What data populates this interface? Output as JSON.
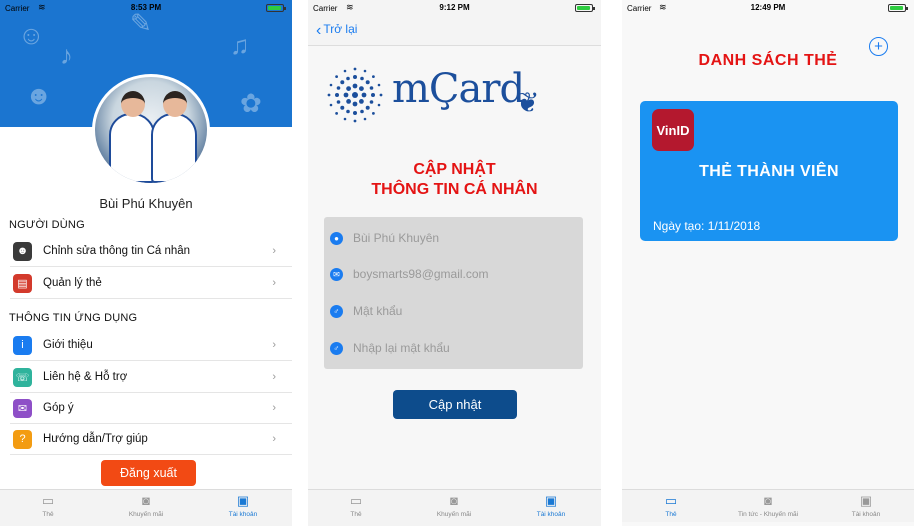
{
  "screen1": {
    "status": {
      "carrier": "Carrier",
      "time": "8:53 PM"
    },
    "profile": {
      "name": "Bùi Phú Khuyên"
    },
    "sections": [
      {
        "title": "NGƯỜI DÙNG",
        "items": [
          {
            "label": "Chỉnh sửa thông tin Cá nhân",
            "icon": "user-edit-icon",
            "color": "#3a3a3a"
          },
          {
            "label": "Quản lý thẻ",
            "icon": "card-manage-icon",
            "color": "#d33a2c"
          }
        ]
      },
      {
        "title": "THÔNG TIN ỨNG DỤNG",
        "items": [
          {
            "label": "Giới thiệu",
            "icon": "info-icon",
            "color": "#1a7cf0"
          },
          {
            "label": "Liên hệ & Hỗ trợ",
            "icon": "support-icon",
            "color": "#2fb39c"
          },
          {
            "label": "Góp ý",
            "icon": "feedback-icon",
            "color": "#8e4fc7"
          },
          {
            "label": "Hướng dẫn/Trợ giúp",
            "icon": "help-icon",
            "color": "#f39c12"
          }
        ]
      }
    ],
    "logout_label": "Đăng xuất",
    "tabs": [
      {
        "label": "Thẻ",
        "icon": "card-icon",
        "active": false
      },
      {
        "label": "Khuyến mãi",
        "icon": "camera-icon",
        "active": false
      },
      {
        "label": "Tài khoản",
        "icon": "account-icon",
        "active": true
      }
    ]
  },
  "screen2": {
    "status": {
      "carrier": "Carrier",
      "time": "9:12 PM"
    },
    "back_label": "Trở lại",
    "logo_text": "mÇard",
    "title_line1": "CẬP NHẬT",
    "title_line2": "THÔNG TIN CÁ NHÂN",
    "fields": [
      {
        "placeholder": "Bùi Phú Khuyên",
        "icon": "user-icon"
      },
      {
        "placeholder": "boysmarts98@gmail.com",
        "icon": "email-icon"
      },
      {
        "placeholder": "Mật khẩu",
        "icon": "password-icon"
      },
      {
        "placeholder": "Nhập lại mật khẩu",
        "icon": "password-confirm-icon"
      }
    ],
    "update_label": "Cập nhật",
    "tabs": [
      {
        "label": "Thẻ",
        "icon": "card-icon",
        "active": false
      },
      {
        "label": "Khuyến mãi",
        "icon": "camera-icon",
        "active": false
      },
      {
        "label": "Tài khoản",
        "icon": "account-icon",
        "active": true
      }
    ]
  },
  "screen3": {
    "status": {
      "carrier": "Carrier",
      "time": "12:49 PM"
    },
    "title": "DANH SÁCH THẺ",
    "card": {
      "logo": "VinID",
      "name": "THẺ THÀNH VIÊN",
      "date": "Ngày tạo: 1/11/2018"
    },
    "tabs": [
      {
        "label": "Thẻ",
        "icon": "card-icon",
        "active": true
      },
      {
        "label": "Tin tức - Khuyến mãi",
        "icon": "camera-icon",
        "active": false
      },
      {
        "label": "Tài khoản",
        "icon": "account-icon",
        "active": false
      }
    ]
  },
  "colors": {
    "primary": "#1a79d4",
    "accent_red": "#e41414",
    "logout": "#f24a14",
    "update_button": "#0d4c8c",
    "card_bg": "#1a93f2"
  }
}
